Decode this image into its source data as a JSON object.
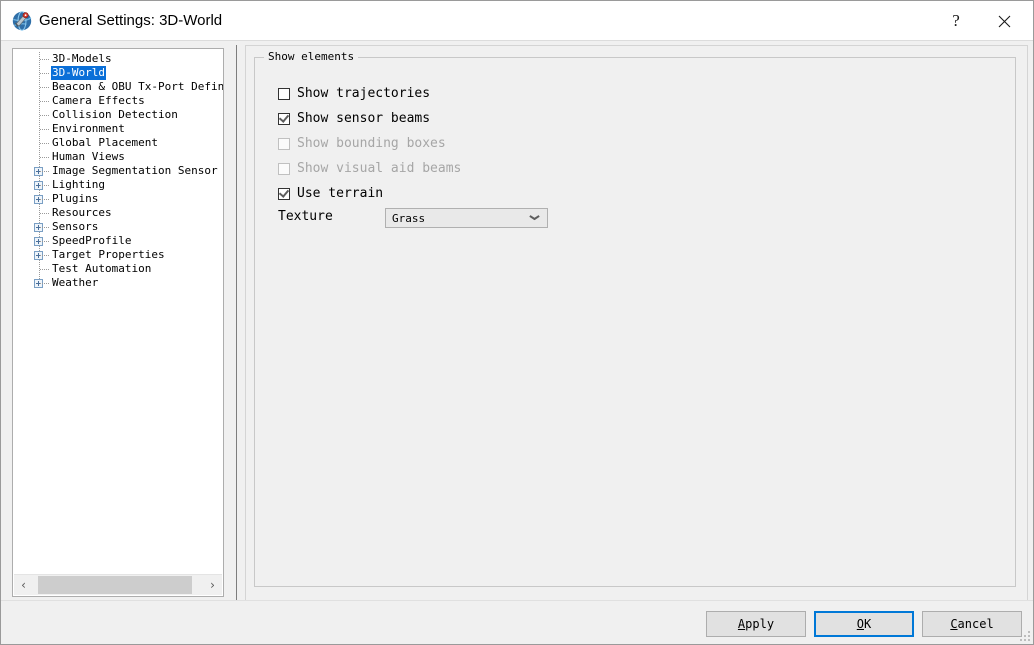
{
  "window": {
    "title": "General Settings: 3D-World",
    "icon": "globe-satellite-icon",
    "help_label": "?",
    "close_label": "✕"
  },
  "tree": {
    "items": [
      {
        "label": "3D-Models",
        "expandable": false,
        "selected": false
      },
      {
        "label": "3D-World",
        "expandable": false,
        "selected": true
      },
      {
        "label": "Beacon & OBU Tx-Port Definitio",
        "expandable": false,
        "selected": false
      },
      {
        "label": "Camera Effects",
        "expandable": false,
        "selected": false
      },
      {
        "label": "Collision Detection",
        "expandable": false,
        "selected": false
      },
      {
        "label": "Environment",
        "expandable": false,
        "selected": false
      },
      {
        "label": "Global Placement",
        "expandable": false,
        "selected": false
      },
      {
        "label": "Human Views",
        "expandable": false,
        "selected": false
      },
      {
        "label": "Image Segmentation Sensor",
        "expandable": true,
        "selected": false
      },
      {
        "label": "Lighting",
        "expandable": true,
        "selected": false
      },
      {
        "label": "Plugins",
        "expandable": true,
        "selected": false
      },
      {
        "label": "Resources",
        "expandable": false,
        "selected": false
      },
      {
        "label": "Sensors",
        "expandable": true,
        "selected": false
      },
      {
        "label": "SpeedProfile",
        "expandable": true,
        "selected": false
      },
      {
        "label": "Target Properties",
        "expandable": true,
        "selected": false
      },
      {
        "label": "Test Automation",
        "expandable": false,
        "selected": false
      },
      {
        "label": "Weather",
        "expandable": true,
        "selected": false
      }
    ],
    "scroll_left_label": "‹",
    "scroll_right_label": "›",
    "selection_color": "#0a6fd8"
  },
  "main": {
    "groupbox_title": "Show elements",
    "checkboxes": [
      {
        "label": "Show trajectories",
        "checked": false,
        "disabled": false
      },
      {
        "label": "Show sensor beams",
        "checked": true,
        "disabled": false
      },
      {
        "label": "Show bounding boxes",
        "checked": false,
        "disabled": true
      },
      {
        "label": "Show visual aid beams",
        "checked": false,
        "disabled": true
      },
      {
        "label": "Use terrain",
        "checked": true,
        "disabled": false
      }
    ],
    "texture": {
      "label": "Texture",
      "value": "Grass",
      "arrow_icon": "chevron-down-icon"
    }
  },
  "footer": {
    "apply": {
      "pre": "A",
      "accel": "",
      "post": "pply",
      "label": "Apply"
    },
    "ok": {
      "label": "OK"
    },
    "cancel": {
      "label": "Cancel"
    },
    "default_button": "ok",
    "accent_color": "#0078d7"
  }
}
